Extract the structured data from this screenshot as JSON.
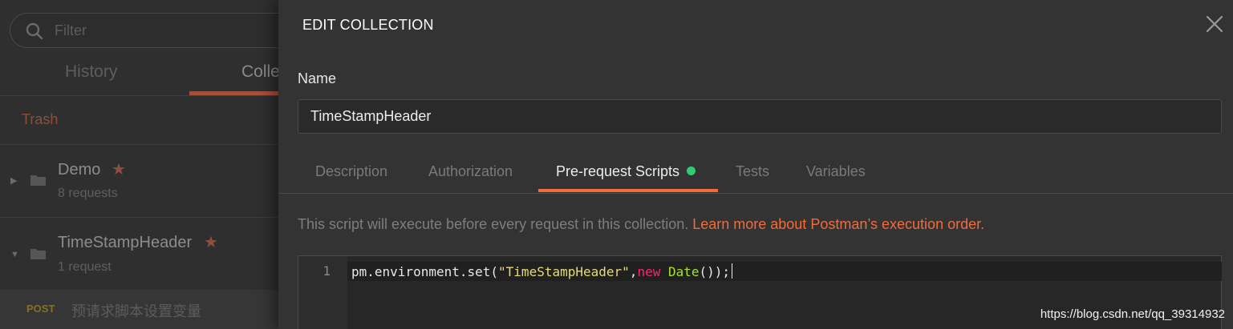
{
  "colors": {
    "accent": "#f26b3a",
    "status_dot": "#2ecc71",
    "sidebar_star": "#8e4e3d",
    "method_post": "#86711c"
  },
  "sidebar": {
    "filter_placeholder": "Filter",
    "search_icon": "search-icon",
    "tabs": [
      {
        "label": "History"
      },
      {
        "label": "Colle",
        "active": true
      }
    ],
    "trash_label": "Trash",
    "collections": [
      {
        "name": "Demo",
        "count": "8 requests",
        "expanded": false,
        "starred": true
      },
      {
        "name": "TimeStampHeader",
        "count": "1 request",
        "expanded": true,
        "starred": true
      }
    ],
    "request": {
      "method": "POST",
      "name": "预请求脚本设置变量"
    }
  },
  "modal": {
    "title": "EDIT COLLECTION",
    "close_icon": "close-icon",
    "name_label": "Name",
    "name_value": "TimeStampHeader",
    "tabs": [
      {
        "label": "Description"
      },
      {
        "label": "Authorization"
      },
      {
        "label": "Pre-request Scripts",
        "active": true,
        "has_dot": true
      },
      {
        "label": "Tests"
      },
      {
        "label": "Variables"
      }
    ],
    "info_text": "This script will execute before every request in this collection. ",
    "info_link": "Learn more about Postman’s execution order.",
    "editor": {
      "line_number": "1",
      "code_prefix": "pm.environment.set(",
      "code_string": "\"TimeStampHeader\"",
      "code_comma": ",",
      "code_keyword": "new",
      "code_space": " ",
      "code_class": "Date",
      "code_suffix": "());"
    }
  },
  "watermark": "https://blog.csdn.net/qq_39314932"
}
